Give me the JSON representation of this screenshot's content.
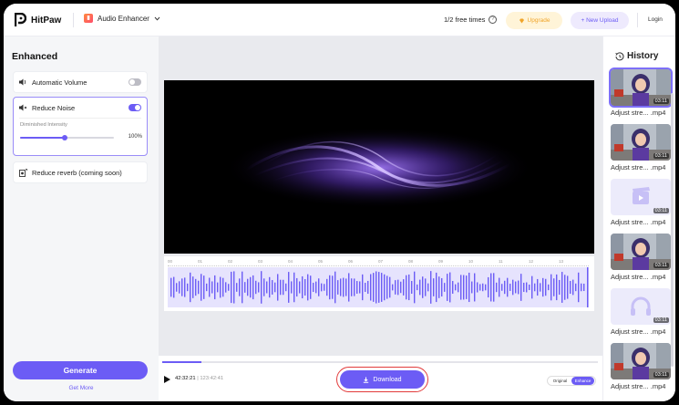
{
  "topbar": {
    "brand": "HitPaw",
    "product": "Audio Enhancer",
    "free_times": "1/2 free times",
    "upgrade_label": "Upgrade",
    "new_upload_label": "+ New Upload",
    "login_label": "Login"
  },
  "left": {
    "title": "Enhanced",
    "options": [
      {
        "label": "Automatic Volume",
        "enabled": false
      },
      {
        "label": "Reduce Noise",
        "enabled": true
      },
      {
        "label": "Reduce reverb (coming soon)"
      }
    ],
    "intensity_label": "Diminished Intensity",
    "intensity_value": "100%",
    "intensity_level": 0.48,
    "generate_label": "Generate",
    "get_more_label": "Get More"
  },
  "waveform": {
    "ticks": [
      "00",
      "01",
      "02",
      "03",
      "04",
      "05",
      "06",
      "07",
      "08",
      "09",
      "10",
      "11",
      "12",
      "13"
    ]
  },
  "player": {
    "current_time": "42:32:21",
    "separator": " | ",
    "total_time": "123:42:41",
    "progress": 0.09,
    "download_label": "Download",
    "compare_original": "Original",
    "compare_enhance": "Enhance"
  },
  "history": {
    "title": "History",
    "items": [
      {
        "name": "Adjust stre... .mp4",
        "duration": "03:11",
        "thumb": "person"
      },
      {
        "name": "Adjust stre... .mp4",
        "duration": "03:11",
        "thumb": "person"
      },
      {
        "name": "Adjust stre... .mp4",
        "duration": "03:11",
        "thumb": "video"
      },
      {
        "name": "Adjust stre... .mp4",
        "duration": "03:11",
        "thumb": "person"
      },
      {
        "name": "Adjust stre... .mp4",
        "duration": "03:11",
        "thumb": "audio"
      },
      {
        "name": "Adjust stre... .mp4",
        "duration": "03:11",
        "thumb": "person"
      }
    ]
  },
  "colors": {
    "accent": "#6c5cf5",
    "upgrade_bg": "#fff4d8",
    "upgrade_text": "#f0a52a",
    "highlight_border": "#e23b3b"
  }
}
